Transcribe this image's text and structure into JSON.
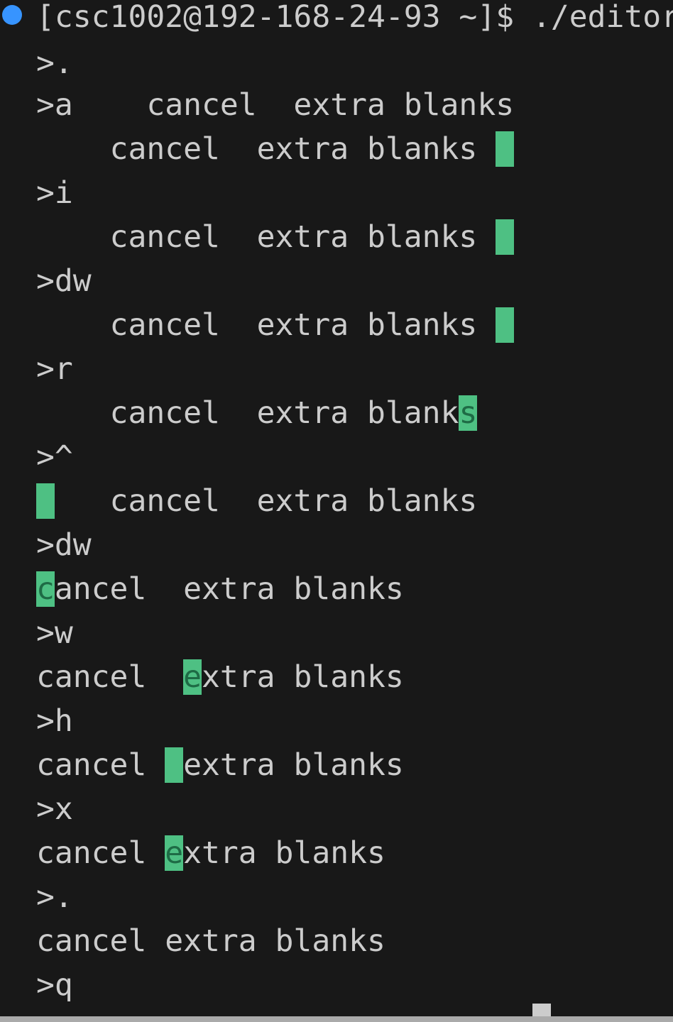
{
  "terminal": {
    "prompt": "[csc1002@192-168-24-93 ~]$ ./editor",
    "lines": [
      ">.",
      ">a    cancel  extra blanks",
      "    cancel  extra blanks ",
      ">i",
      "    cancel  extra blanks ",
      ">dw",
      "    cancel  extra blanks ",
      ">r",
      "    cancel  extra blanks",
      ">^",
      "    cancel  extra blanks",
      ">dw",
      "cancel  extra blanks",
      ">w",
      "cancel  extra blanks",
      ">h",
      "cancel  extra blanks",
      ">x",
      "cancel extra blanks",
      ">.",
      "cancel extra blanks",
      ">q"
    ],
    "colors": {
      "background": "#181818",
      "text": "#cccccc",
      "cursor": "#4ec083",
      "prompt_dot": "#3794ff"
    }
  }
}
